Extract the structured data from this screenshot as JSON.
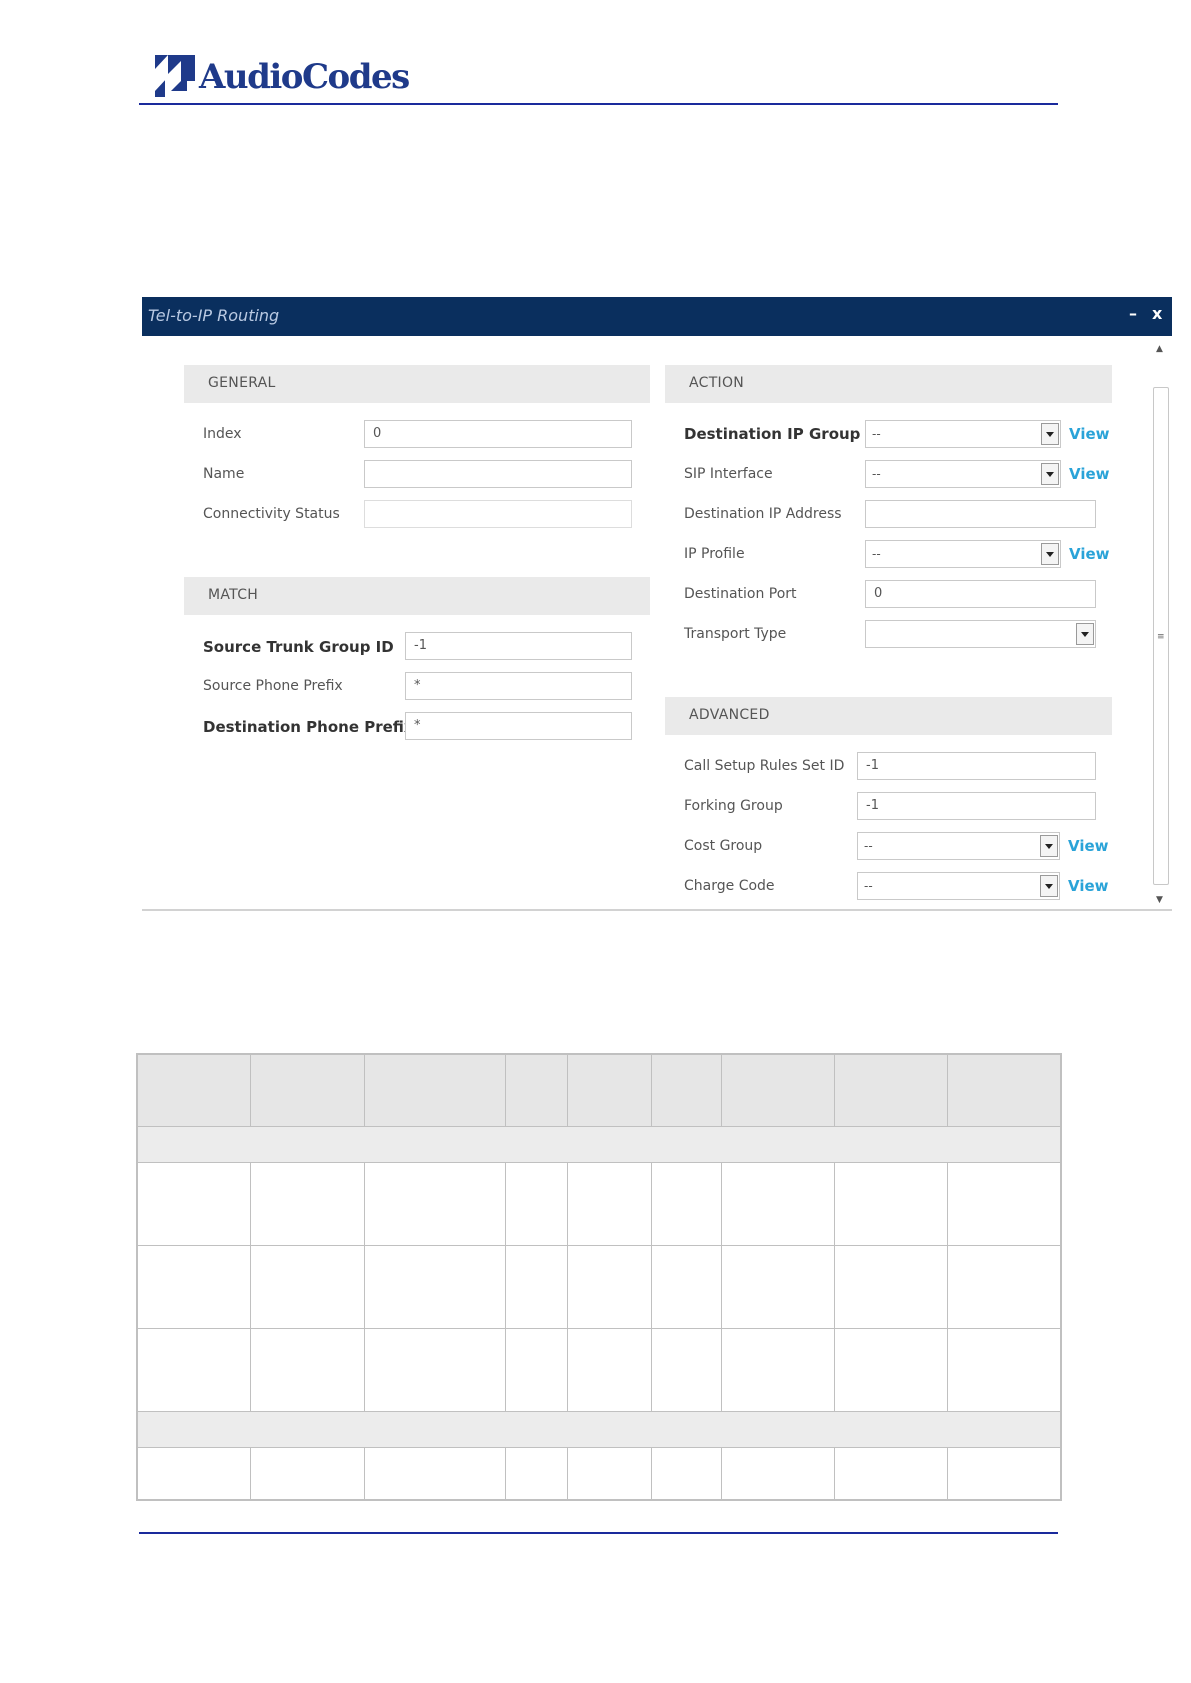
{
  "header": {
    "logo_text": "AudioCodes",
    "brand_color": "#1f3a8a"
  },
  "dialog": {
    "title": "Tel-to-IP Routing",
    "minimize_label": "–",
    "close_label": "x",
    "general": {
      "heading": "GENERAL",
      "index_label": "Index",
      "index_value": "0",
      "name_label": "Name",
      "name_value": "",
      "connectivity_label": "Connectivity Status",
      "connectivity_value": ""
    },
    "match": {
      "heading": "MATCH",
      "source_trunk_label": "Source Trunk Group ID",
      "source_trunk_value": "-1",
      "source_prefix_label": "Source Phone Prefix",
      "source_prefix_value": "*",
      "dest_prefix_label": "Destination Phone Prefix",
      "dest_prefix_value": "*"
    },
    "action": {
      "heading": "ACTION",
      "dest_ip_group_label": "Destination IP Group",
      "dest_ip_group_value": "--",
      "sip_interface_label": "SIP Interface",
      "sip_interface_value": "--",
      "dest_ip_address_label": "Destination IP Address",
      "dest_ip_address_value": "",
      "ip_profile_label": "IP Profile",
      "ip_profile_value": "--",
      "dest_port_label": "Destination Port",
      "dest_port_value": "0",
      "transport_label": "Transport Type",
      "transport_value": "",
      "view_label": "View"
    },
    "advanced": {
      "heading": "ADVANCED",
      "call_setup_label": "Call Setup Rules Set ID",
      "call_setup_value": "-1",
      "forking_label": "Forking Group",
      "forking_value": "-1",
      "cost_group_label": "Cost Group",
      "cost_group_value": "--",
      "charge_code_label": "Charge Code",
      "charge_code_value": "--"
    }
  },
  "colors": {
    "titlebar": "#0a2f5e",
    "view_link": "#2aa3d8",
    "rule": "#1a2a9c"
  }
}
